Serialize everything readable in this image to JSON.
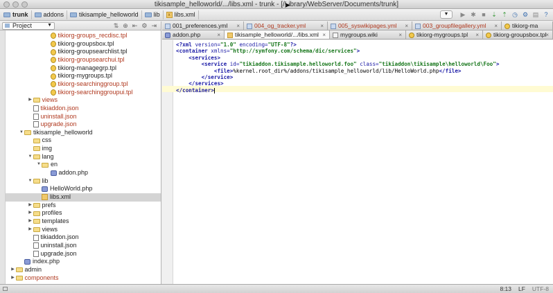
{
  "window": {
    "title": "tikisample_helloworld/.../libs.xml - trunk - [/Library/WebServer/Documents/trunk]"
  },
  "breadcrumb": [
    "trunk",
    "addons",
    "tikisample_helloworld",
    "lib",
    "libs.xml"
  ],
  "project_panel": {
    "label": "Project"
  },
  "tree": [
    {
      "label": "tikiorg-groups_recdisc.tpl",
      "type": "tpl",
      "color": "red",
      "depth": 5
    },
    {
      "label": "tikiorg-groupsbox.tpl",
      "type": "tpl",
      "color": "normal",
      "depth": 5
    },
    {
      "label": "tikiorg-groupsearchlist.tpl",
      "type": "tpl",
      "color": "normal",
      "depth": 5
    },
    {
      "label": "tikiorg-groupsearchui.tpl",
      "type": "tpl",
      "color": "red",
      "depth": 5
    },
    {
      "label": "tikiorg-managegrp.tpl",
      "type": "tpl",
      "color": "normal",
      "depth": 5
    },
    {
      "label": "tikiorg-mygroups.tpl",
      "type": "tpl",
      "color": "normal",
      "depth": 5
    },
    {
      "label": "tikiorg-searchinggroup.tpl",
      "type": "tpl",
      "color": "red",
      "depth": 5
    },
    {
      "label": "tikiorg-searchinggroupui.tpl",
      "type": "tpl",
      "color": "red",
      "depth": 5
    },
    {
      "label": "views",
      "type": "folder",
      "color": "red",
      "depth": 3,
      "arrow": "right"
    },
    {
      "label": "tikiaddon.json",
      "type": "json",
      "color": "red",
      "depth": 3
    },
    {
      "label": "uninstall.json",
      "type": "json",
      "color": "red",
      "depth": 3
    },
    {
      "label": "upgrade.json",
      "type": "json",
      "color": "red",
      "depth": 3
    },
    {
      "label": "tikisample_helloworld",
      "type": "folder",
      "color": "normal",
      "depth": 2,
      "arrow": "down"
    },
    {
      "label": "css",
      "type": "folder",
      "color": "normal",
      "depth": 3
    },
    {
      "label": "img",
      "type": "folder",
      "color": "normal",
      "depth": 3
    },
    {
      "label": "lang",
      "type": "folder",
      "color": "normal",
      "depth": 3,
      "arrow": "down"
    },
    {
      "label": "en",
      "type": "folder",
      "color": "normal",
      "depth": 4,
      "arrow": "down"
    },
    {
      "label": "addon.php",
      "type": "php",
      "color": "normal",
      "depth": 5
    },
    {
      "label": "lib",
      "type": "folder",
      "color": "normal",
      "depth": 3,
      "arrow": "down"
    },
    {
      "label": "HelloWorld.php",
      "type": "php",
      "color": "normal",
      "depth": 4
    },
    {
      "label": "libs.xml",
      "type": "xml",
      "color": "normal",
      "depth": 4,
      "selected": true
    },
    {
      "label": "prefs",
      "type": "folder",
      "color": "normal",
      "depth": 3,
      "arrow": "right"
    },
    {
      "label": "profiles",
      "type": "folder",
      "color": "normal",
      "depth": 3,
      "arrow": "right"
    },
    {
      "label": "templates",
      "type": "folder",
      "color": "normal",
      "depth": 3,
      "arrow": "right"
    },
    {
      "label": "views",
      "type": "folder",
      "color": "normal",
      "depth": 3,
      "arrow": "right"
    },
    {
      "label": "tikiaddon.json",
      "type": "json",
      "color": "normal",
      "depth": 3
    },
    {
      "label": "uninstall.json",
      "type": "json",
      "color": "normal",
      "depth": 3
    },
    {
      "label": "upgrade.json",
      "type": "json",
      "color": "normal",
      "depth": 3
    },
    {
      "label": "index.php",
      "type": "php",
      "color": "normal",
      "depth": 2
    },
    {
      "label": "admin",
      "type": "folder",
      "color": "normal",
      "depth": 1,
      "arrow": "right"
    },
    {
      "label": "components",
      "type": "folder",
      "color": "red",
      "depth": 1,
      "arrow": "right"
    }
  ],
  "tabs_row1": [
    {
      "label": "001_preferences.yml",
      "icon": "yml"
    },
    {
      "label": "004_og_tracker.yml",
      "icon": "yml",
      "color": "red"
    },
    {
      "label": "005_syswikipages.yml",
      "icon": "yml",
      "color": "red"
    },
    {
      "label": "003_groupfilegallery.yml",
      "icon": "yml",
      "color": "red"
    },
    {
      "label": "tikiorg-ma",
      "icon": "tpl"
    }
  ],
  "tabs_row2": [
    {
      "label": "addon.php",
      "icon": "php"
    },
    {
      "label": "tikisample_helloworld/.../libs.xml",
      "icon": "xml",
      "active": true
    },
    {
      "label": "mygroups.wiki",
      "icon": "wiki"
    },
    {
      "label": "tikiorg-mygroups.tpl",
      "icon": "tpl"
    },
    {
      "label": "tikiorg-groupsbox.tpl",
      "icon": "tpl"
    }
  ],
  "code": [
    [
      [
        "<?",
        "tag"
      ],
      [
        "xml ",
        "tag"
      ],
      [
        "version=",
        "attr"
      ],
      [
        "\"1.0\"",
        "str"
      ],
      [
        " encoding=",
        "attr"
      ],
      [
        "\"UTF-8\"",
        "str"
      ],
      [
        "?>",
        "tag"
      ]
    ],
    [
      [
        "<container ",
        "tag"
      ],
      [
        "xmlns=",
        "attr"
      ],
      [
        "\"http://symfony.com/schema/dic/services\"",
        "str"
      ],
      [
        ">",
        "tag"
      ]
    ],
    [
      [
        "    ",
        "txt"
      ],
      [
        "<services>",
        "tag"
      ]
    ],
    [
      [
        "        ",
        "txt"
      ],
      [
        "<service ",
        "tag"
      ],
      [
        "id=",
        "attr"
      ],
      [
        "\"tikiaddon.tikisample.helloworld.foo\"",
        "str"
      ],
      [
        " class=",
        "attr"
      ],
      [
        "\"tikiaddon\\tikisample\\helloworld\\Foo\"",
        "str"
      ],
      [
        ">",
        "tag"
      ]
    ],
    [
      [
        "            ",
        "txt"
      ],
      [
        "<file>",
        "tag"
      ],
      [
        "%kernel.root_dir%/addons/tikisample_helloworld/lib/HelloWorld.php",
        "txt"
      ],
      [
        "</file>",
        "tag"
      ]
    ],
    [
      [
        "        ",
        "txt"
      ],
      [
        "</service>",
        "tag"
      ]
    ],
    [
      [
        "    ",
        "txt"
      ],
      [
        "</services>",
        "tag"
      ]
    ],
    [
      [
        "</container>",
        "tag"
      ]
    ]
  ],
  "status": {
    "position": "8:13",
    "line_sep": "LF",
    "encoding": "UTF-8"
  }
}
